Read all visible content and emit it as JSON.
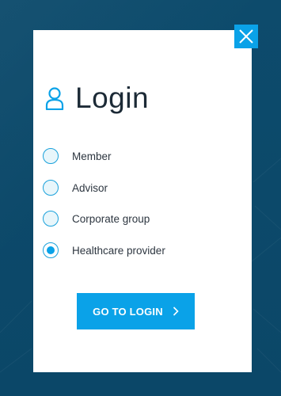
{
  "modal": {
    "title": "Login",
    "icons": {
      "user": "user-icon",
      "close": "close-icon",
      "arrow": "chevron-right-icon"
    },
    "options": [
      {
        "label": "Member",
        "checked": false
      },
      {
        "label": "Advisor",
        "checked": false
      },
      {
        "label": "Corporate group",
        "checked": false
      },
      {
        "label": "Healthcare provider",
        "checked": true
      }
    ],
    "cta_label": "GO TO LOGIN"
  },
  "colors": {
    "backdrop": "#0c4a6e",
    "accent": "#0aa2e8",
    "modal_bg": "#ffffff",
    "text": "#1c2a36"
  }
}
